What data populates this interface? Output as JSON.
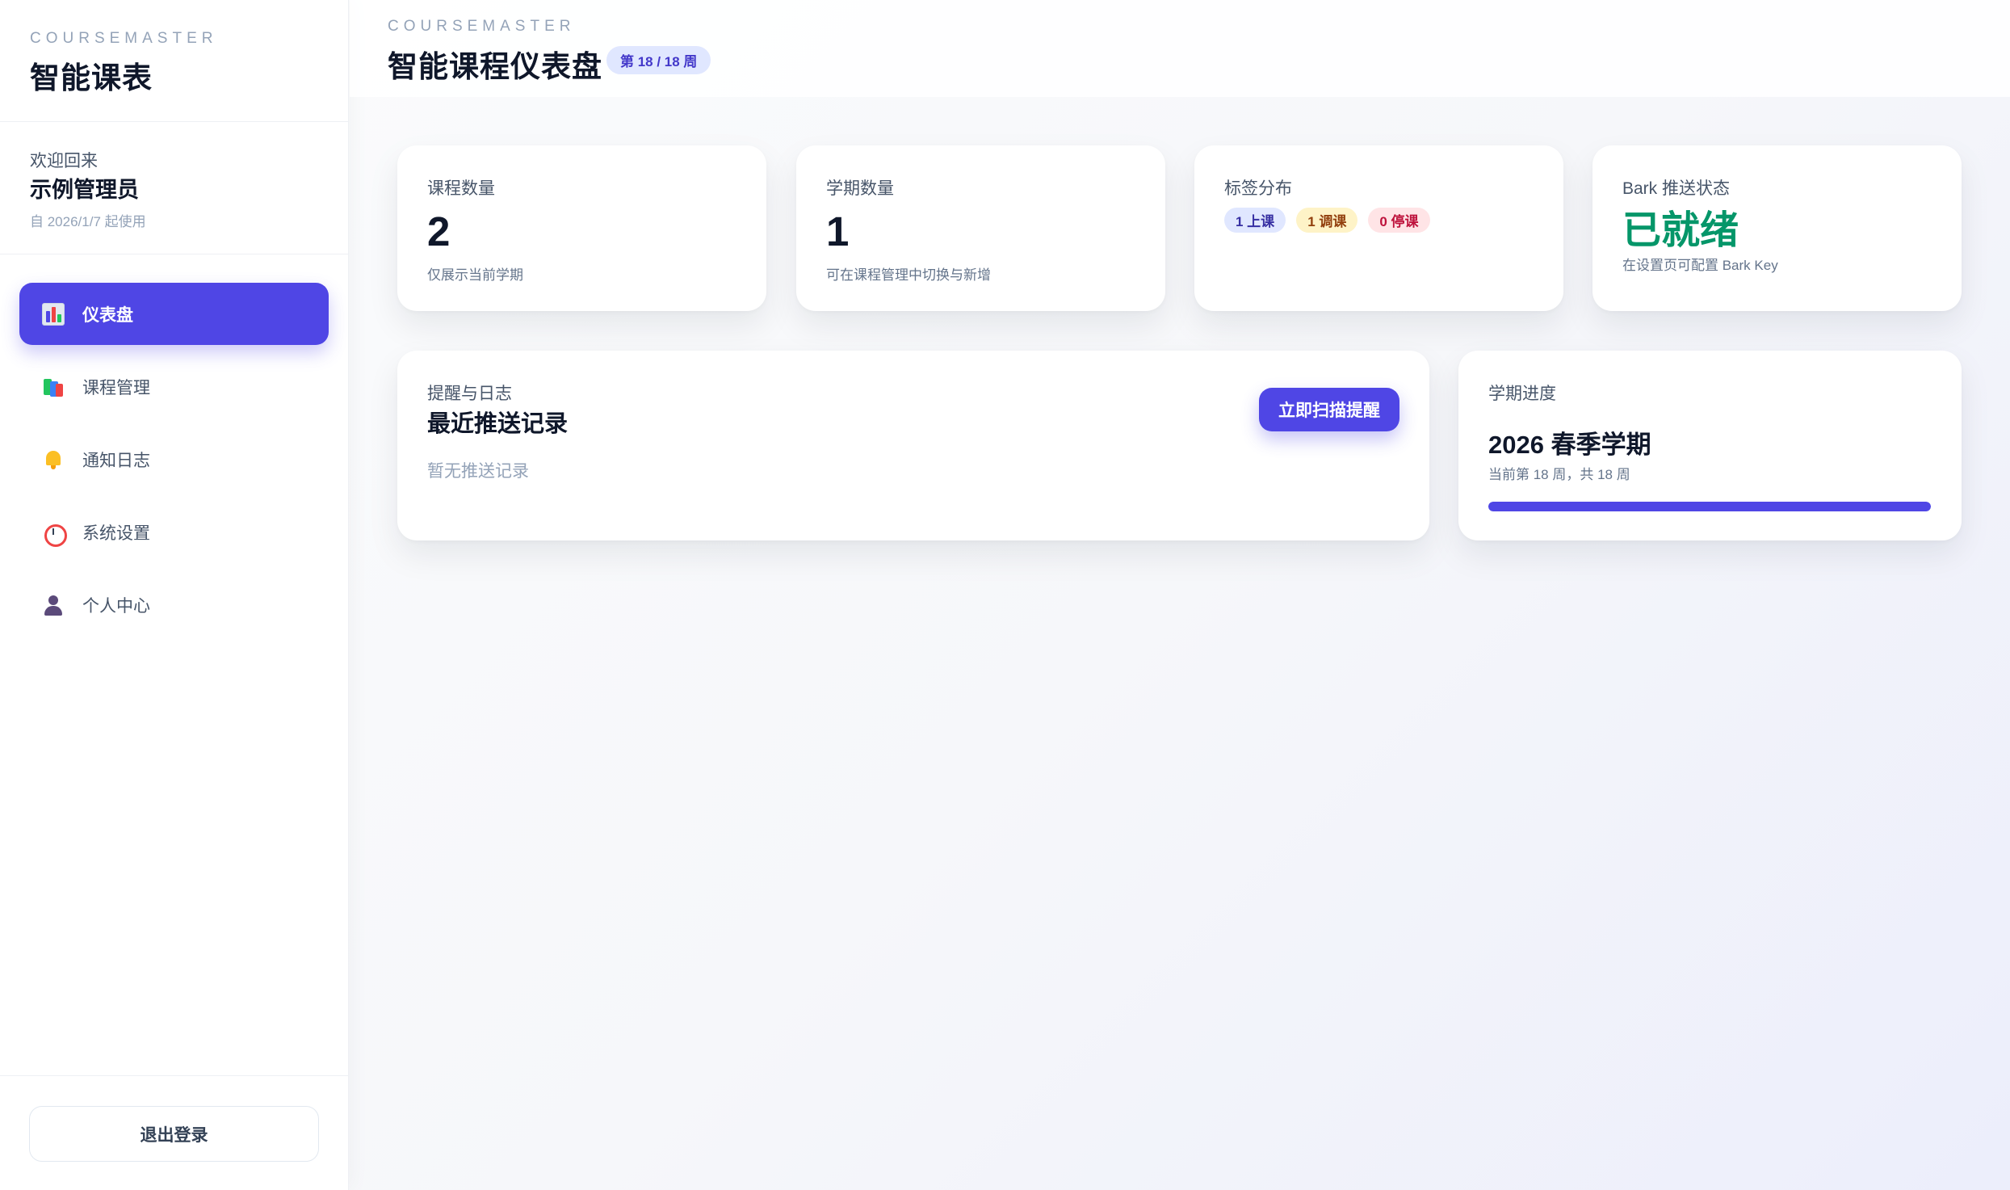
{
  "sidebar": {
    "brand_kicker": "COURSEMASTER",
    "brand_title": "智能课表",
    "user": {
      "welcome": "欢迎回来",
      "name": "示例管理员",
      "since": "自 2026/1/7 起使用"
    },
    "nav": [
      {
        "label": "仪表盘",
        "icon": "chart-icon",
        "active": true
      },
      {
        "label": "课程管理",
        "icon": "books-icon",
        "active": false
      },
      {
        "label": "通知日志",
        "icon": "bell-icon",
        "active": false
      },
      {
        "label": "系统设置",
        "icon": "alarm-clock-icon",
        "active": false
      },
      {
        "label": "个人中心",
        "icon": "person-icon",
        "active": false
      }
    ],
    "logout_label": "退出登录"
  },
  "header": {
    "kicker": "COURSEMASTER",
    "title": "智能课程仪表盘",
    "week_badge": "第 18 / 18 周"
  },
  "stats": {
    "courses": {
      "label": "课程数量",
      "value": "2",
      "hint": "仅展示当前学期"
    },
    "semesters": {
      "label": "学期数量",
      "value": "1",
      "hint": "可在课程管理中切换与新增"
    },
    "tags": {
      "label": "标签分布",
      "items": [
        {
          "text": "1 上课",
          "bg": "#e0e7ff",
          "fg": "#3730a3"
        },
        {
          "text": "1 调课",
          "bg": "#fef3c7",
          "fg": "#92400e"
        },
        {
          "text": "0 停课",
          "bg": "#ffe4e6",
          "fg": "#be123c"
        }
      ]
    },
    "bark": {
      "label": "Bark 推送状态",
      "status": "已就绪",
      "hint": "在设置页可配置 Bark Key",
      "status_color": "#059669"
    }
  },
  "logs": {
    "kicker": "提醒与日志",
    "title": "最近推送记录",
    "empty": "暂无推送记录",
    "scan_button": "立即扫描提醒"
  },
  "progress": {
    "label": "学期进度",
    "term": "2026 春季学期",
    "sub": "当前第 18 周，共 18 周",
    "fraction": 1.0
  },
  "colors": {
    "accent": "#4f46e5",
    "success": "#059669"
  }
}
